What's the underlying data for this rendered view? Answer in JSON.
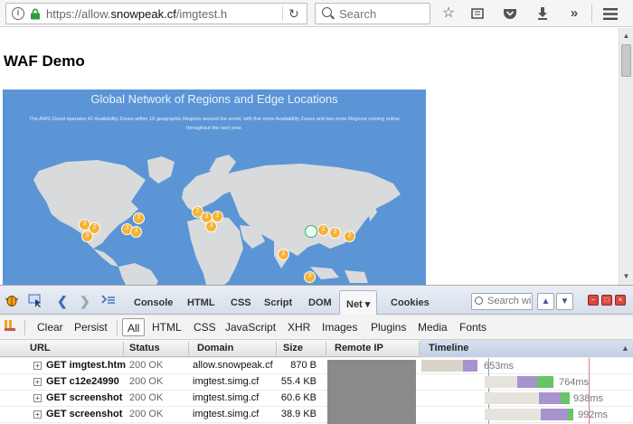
{
  "browser": {
    "url_prefix": "https://allow.",
    "url_domain": "snowpeak.cf",
    "url_path": "/imgtest.h",
    "search_placeholder": "Search"
  },
  "page": {
    "heading": "WAF Demo",
    "map_title": "Global Network of Regions and Edge Locations",
    "map_subtitle": "The AWS Cloud operates 42 Availability Zones within 16 geographic Regions around the world, with five more Availability Zones and two more Regions coming online throughout the next year.",
    "markers": [
      {
        "label": "3"
      },
      {
        "label": "2"
      },
      {
        "label": "3"
      },
      {
        "label": "2"
      },
      {
        "label": "3"
      },
      {
        "label": "3"
      },
      {
        "label": "2"
      },
      {
        "label": "3"
      },
      {
        "label": "2"
      },
      {
        "label": "3"
      },
      {
        "label": "2"
      },
      {
        "label": "3"
      },
      {
        "label": "2"
      },
      {
        "label": "2"
      },
      {
        "label": "3"
      },
      {
        "label": "2"
      },
      {
        "label": "2"
      }
    ]
  },
  "firebug": {
    "tabs": [
      "Console",
      "HTML",
      "CSS",
      "Script",
      "DOM",
      "Net ▾",
      "Cookies"
    ],
    "active_tab": "Net ▾",
    "search_placeholder": "Search wi",
    "filters": {
      "clear": "Clear",
      "persist": "Persist",
      "types": [
        "All",
        "HTML",
        "CSS",
        "JavaScript",
        "XHR",
        "Images",
        "Plugins",
        "Media",
        "Fonts"
      ]
    },
    "columns": [
      "URL",
      "Status",
      "Domain",
      "Size",
      "Remote IP",
      "Timeline"
    ],
    "requests": [
      {
        "url": "GET imgtest.htm",
        "status": "200 OK",
        "domain": "allow.snowpeak.cf",
        "size": "870 B",
        "time": "653ms"
      },
      {
        "url": "GET c12e24990",
        "status": "200 OK",
        "domain": "imgtest.simg.cf",
        "size": "55.4 KB",
        "time": "764ms"
      },
      {
        "url": "GET screenshot",
        "status": "200 OK",
        "domain": "imgtest.simg.cf",
        "size": "60.6 KB",
        "time": "938ms"
      },
      {
        "url": "GET screenshot",
        "status": "200 OK",
        "domain": "imgtest.simg.cf",
        "size": "38.9 KB",
        "time": "992ms"
      }
    ]
  }
}
